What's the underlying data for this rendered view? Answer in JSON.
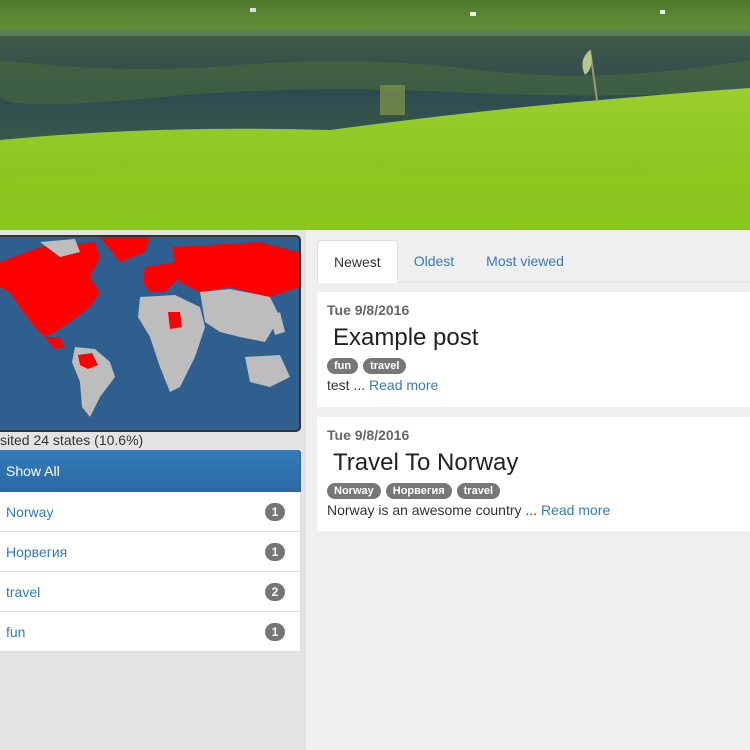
{
  "map": {
    "visited_text": "sited 24 states (10.6%)"
  },
  "tags_panel": {
    "show_all": "Show All",
    "items": [
      {
        "label": "Norway",
        "count": "1"
      },
      {
        "label": "Норвегия",
        "count": "1"
      },
      {
        "label": "travel",
        "count": "2"
      },
      {
        "label": "fun",
        "count": "1"
      }
    ]
  },
  "tabs": [
    "Newest",
    "Oldest",
    "Most viewed"
  ],
  "posts": [
    {
      "date": "Tue 9/8/2016",
      "title": "Example post",
      "tags": [
        "fun",
        "travel"
      ],
      "excerpt": "test ...",
      "read_more": "Read more"
    },
    {
      "date": "Tue 9/8/2016",
      "title": "Travel To Norway",
      "tags": [
        "Norway",
        "Норвегия",
        "travel"
      ],
      "excerpt": "Norway is an awesome country ...",
      "read_more": "Read more"
    }
  ],
  "colors": {
    "accent": "#337ab7",
    "visited": "#ff0000",
    "ocean": "#2f5f8e",
    "land": "#bdbdbd"
  }
}
